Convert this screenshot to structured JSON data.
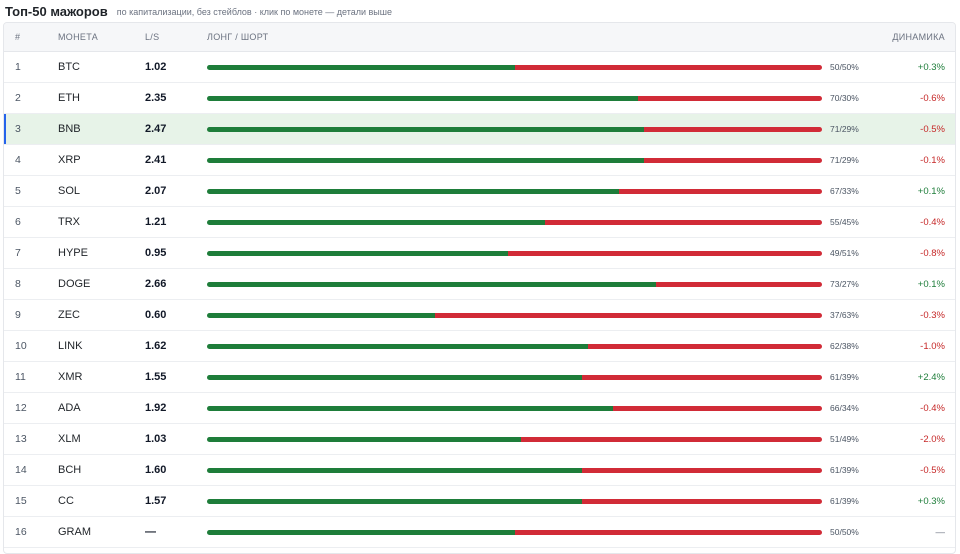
{
  "header": {
    "title": "Топ-50 мажоров",
    "subtitle": "по капитализации, без стейблов · клик по монете — детали выше"
  },
  "columns": {
    "num": "#",
    "coin": "МОНЕТА",
    "ls": "L/S",
    "bar": "ЛОНГ / ШОРТ",
    "dyn": "ДИНАМИКА"
  },
  "colors": {
    "long": "#1e7d3a",
    "short": "#d12b37",
    "positive": "#1e7d3a",
    "negative": "#c62828",
    "neutral": "#6b7280",
    "selected_row": "#e7f3e8",
    "selected_marker": "#2563eb"
  },
  "selected_index": 2,
  "rows": [
    {
      "num": "1",
      "coin": "BTC",
      "ls": "1.02",
      "long": 50,
      "pct": "50/50%",
      "dyn": "+0.3%",
      "trend": "positive"
    },
    {
      "num": "2",
      "coin": "ETH",
      "ls": "2.35",
      "long": 70,
      "pct": "70/30%",
      "dyn": "-0.6%",
      "trend": "negative"
    },
    {
      "num": "3",
      "coin": "BNB",
      "ls": "2.47",
      "long": 71,
      "pct": "71/29%",
      "dyn": "-0.5%",
      "trend": "negative"
    },
    {
      "num": "4",
      "coin": "XRP",
      "ls": "2.41",
      "long": 71,
      "pct": "71/29%",
      "dyn": "-0.1%",
      "trend": "negative"
    },
    {
      "num": "5",
      "coin": "SOL",
      "ls": "2.07",
      "long": 67,
      "pct": "67/33%",
      "dyn": "+0.1%",
      "trend": "positive"
    },
    {
      "num": "6",
      "coin": "TRX",
      "ls": "1.21",
      "long": 55,
      "pct": "55/45%",
      "dyn": "-0.4%",
      "trend": "negative"
    },
    {
      "num": "7",
      "coin": "HYPE",
      "ls": "0.95",
      "long": 49,
      "pct": "49/51%",
      "dyn": "-0.8%",
      "trend": "negative"
    },
    {
      "num": "8",
      "coin": "DOGE",
      "ls": "2.66",
      "long": 73,
      "pct": "73/27%",
      "dyn": "+0.1%",
      "trend": "positive"
    },
    {
      "num": "9",
      "coin": "ZEC",
      "ls": "0.60",
      "long": 37,
      "pct": "37/63%",
      "dyn": "-0.3%",
      "trend": "negative"
    },
    {
      "num": "10",
      "coin": "LINK",
      "ls": "1.62",
      "long": 62,
      "pct": "62/38%",
      "dyn": "-1.0%",
      "trend": "negative"
    },
    {
      "num": "11",
      "coin": "XMR",
      "ls": "1.55",
      "long": 61,
      "pct": "61/39%",
      "dyn": "+2.4%",
      "trend": "positive"
    },
    {
      "num": "12",
      "coin": "ADA",
      "ls": "1.92",
      "long": 66,
      "pct": "66/34%",
      "dyn": "-0.4%",
      "trend": "negative"
    },
    {
      "num": "13",
      "coin": "XLM",
      "ls": "1.03",
      "long": 51,
      "pct": "51/49%",
      "dyn": "-2.0%",
      "trend": "negative"
    },
    {
      "num": "14",
      "coin": "BCH",
      "ls": "1.60",
      "long": 61,
      "pct": "61/39%",
      "dyn": "-0.5%",
      "trend": "negative"
    },
    {
      "num": "15",
      "coin": "CC",
      "ls": "1.57",
      "long": 61,
      "pct": "61/39%",
      "dyn": "+0.3%",
      "trend": "positive"
    },
    {
      "num": "16",
      "coin": "GRAM",
      "ls": "—",
      "long": 50,
      "pct": "50/50%",
      "dyn": "—",
      "trend": "neutral"
    }
  ]
}
